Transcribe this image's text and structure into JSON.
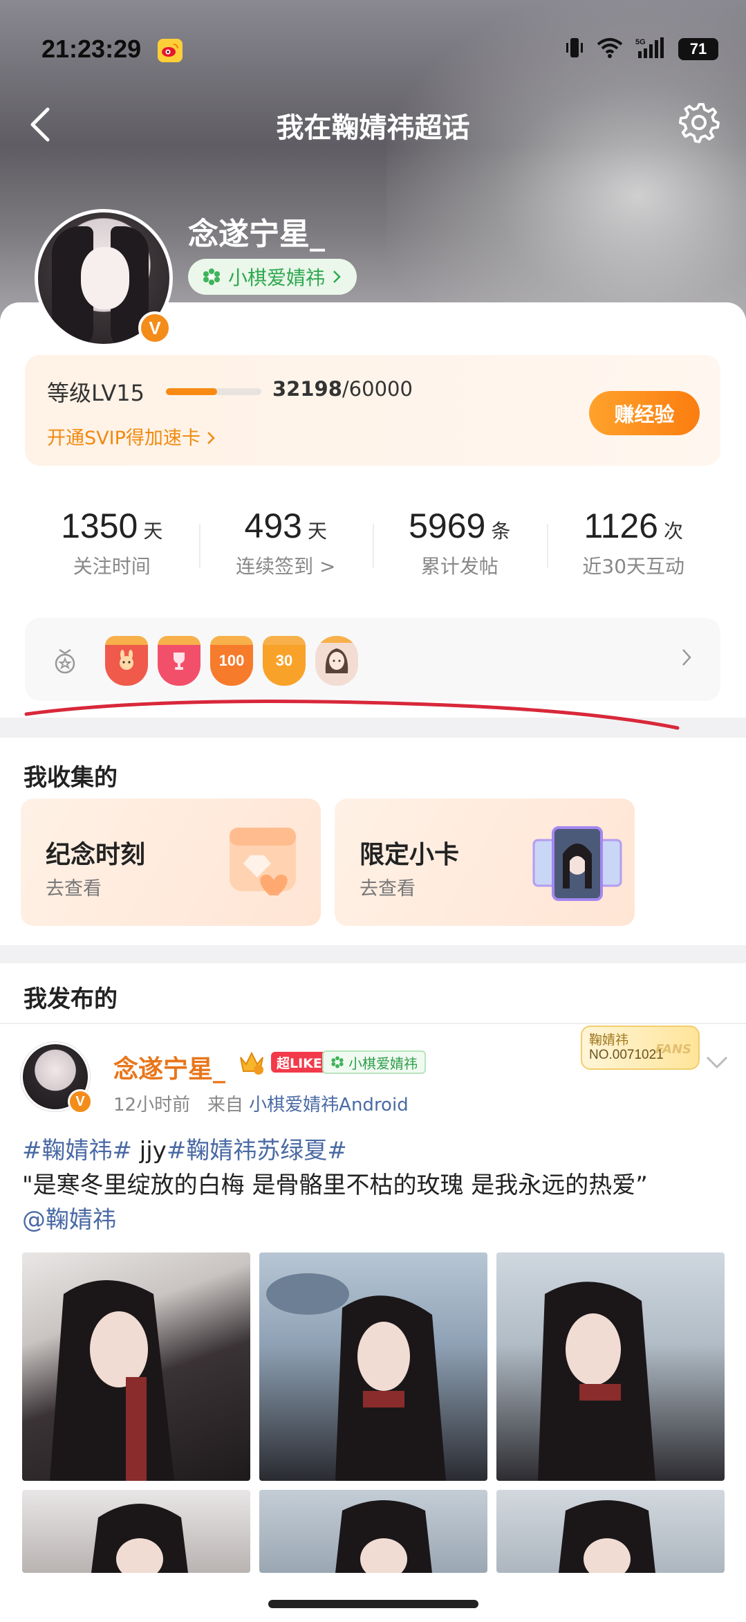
{
  "status_bar": {
    "time": "21:23:29",
    "battery": "71",
    "network": "5G"
  },
  "nav": {
    "title": "我在鞠婧祎超话"
  },
  "profile": {
    "username": "念遂宁星_",
    "topic_tag": "小棋爱婧祎",
    "verified_badge": "V"
  },
  "level": {
    "label": "等级LV15",
    "exp_current": "32198",
    "exp_total": "/60000",
    "progress": 0.537,
    "svip_link": "开通SVIP得加速卡",
    "earn_button": "赚经验"
  },
  "stats": [
    {
      "value": "1350",
      "unit": "天",
      "label": "关注时间"
    },
    {
      "value": "493",
      "unit": "天",
      "label": "连续签到 >"
    },
    {
      "value": "5969",
      "unit": "条",
      "label": "累计发帖"
    },
    {
      "value": "1126",
      "unit": "次",
      "label": "近30天互动"
    }
  ],
  "badges": [
    {
      "name": "rabbit-badge",
      "text": "",
      "color": "#f05a4a"
    },
    {
      "name": "trophy-badge",
      "text": "",
      "color": "#f2506a"
    },
    {
      "name": "100-days-badge",
      "text": "100",
      "color": "#f67b2b"
    },
    {
      "name": "30-days-badge",
      "text": "30",
      "color": "#f9a22a"
    },
    {
      "name": "avatar-badge",
      "text": "",
      "color": "#f3ddd3"
    }
  ],
  "collections": {
    "title": "我收集的",
    "items": [
      {
        "title": "纪念时刻",
        "sub": "去查看"
      },
      {
        "title": "限定小卡",
        "sub": "去查看"
      }
    ]
  },
  "posts": {
    "title": "我发布的",
    "post": {
      "author": "念遂宁星_",
      "like_tag": "超LIKE",
      "fan_tag": "小棋爱婧祎",
      "time": "12小时前",
      "from_label": "来自",
      "source": "小棋爱婧祎Android",
      "fans_badge_name": "鞠婧祎",
      "fans_badge_no": "NO.0071021",
      "fans_badge_word": "FANS",
      "hashtag1": "#鞠婧祎#",
      "text_mid": " jjy",
      "hashtag2": "#鞠婧祎苏绿夏#",
      "quote": "\"是寒冬里绽放的白梅 是骨骼里不枯的玫瑰 是我永远的热爱”",
      "mention": "@鞠婧祎"
    }
  },
  "colors": {
    "accent_orange": "#f88a14",
    "link_blue": "#4a6aa5",
    "green_tag": "#2ea74f",
    "annotation_red": "#d8283a"
  }
}
